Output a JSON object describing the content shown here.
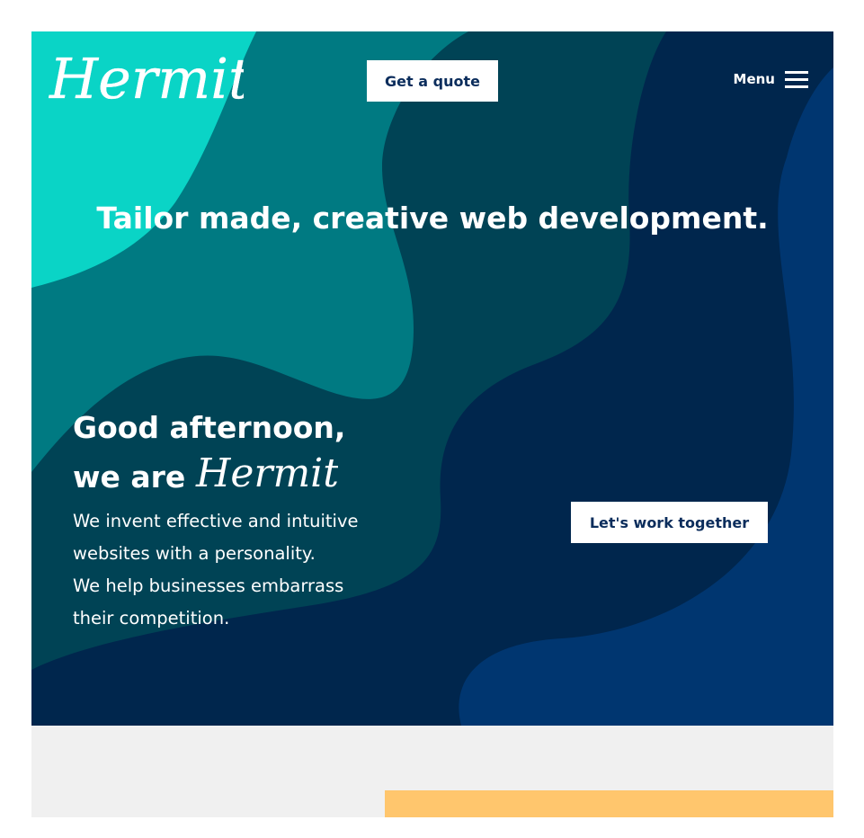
{
  "colors": {
    "accent": "#0ad4c6",
    "dark_navy": "#00264d",
    "button_text": "#0b2d5c",
    "section_bg": "#f0f0f0",
    "highlight": "#ffc66d"
  },
  "header": {
    "logo_text": "Hermit",
    "quote_button": "Get a quote",
    "menu_label": "Menu",
    "menu_icon": "hamburger-icon"
  },
  "hero": {
    "tagline": "Tailor made, creative web development.",
    "greeting_line1": "Good afternoon,",
    "greeting_line2": "we are",
    "greeting_brand": "Hermit",
    "intro_lines": [
      "We invent effective and intuitive",
      "websites with a personality.",
      "We help businesses embarrass",
      "their competition."
    ],
    "cta_button": "Let's work together"
  }
}
